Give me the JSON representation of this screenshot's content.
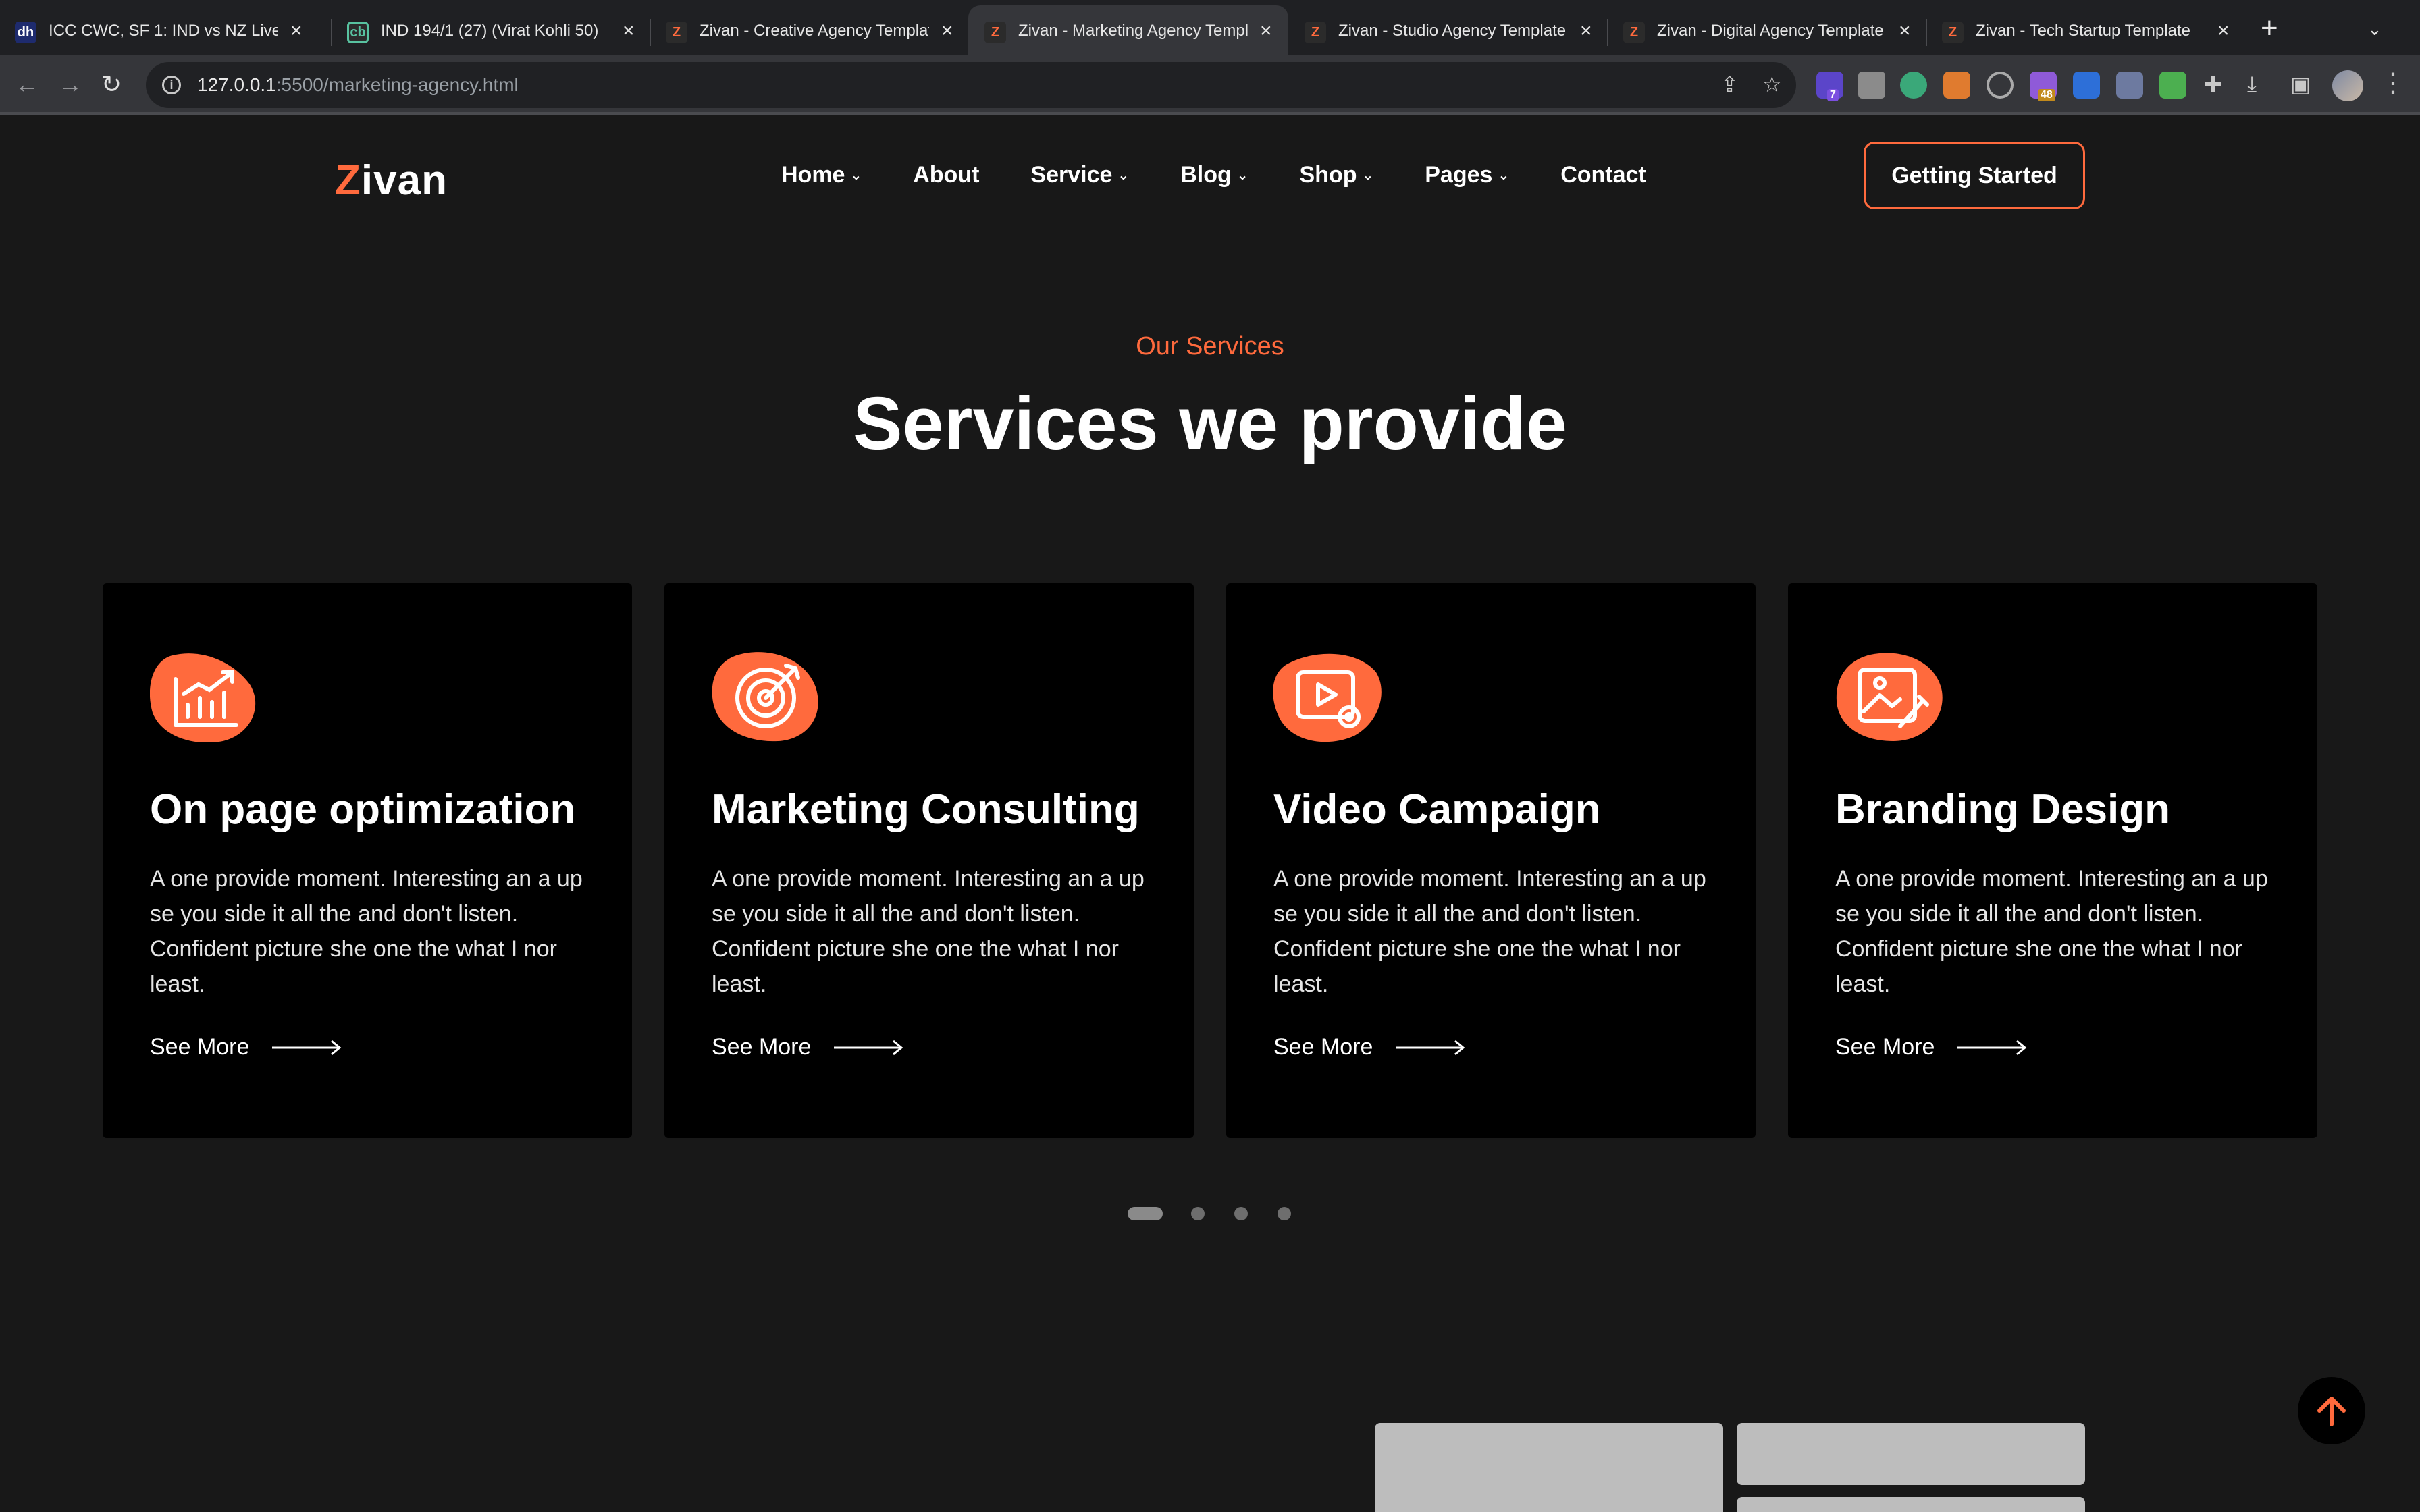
{
  "browser": {
    "tabs": [
      {
        "title": "ICC CWC, SF 1: IND vs NZ Live",
        "favicon": "dh-favicon"
      },
      {
        "title": "IND 194/1 (27) (Virat Kohli 50)",
        "favicon": "cricbuzz-favicon"
      },
      {
        "title": "Zivan - Creative Agency Template",
        "favicon": "zivan-favicon"
      },
      {
        "title": "Zivan - Marketing Agency Template",
        "favicon": "zivan-favicon",
        "active": true
      },
      {
        "title": "Zivan - Studio Agency Template",
        "favicon": "zivan-favicon"
      },
      {
        "title": "Zivan - Digital Agency Template",
        "favicon": "zivan-favicon"
      },
      {
        "title": "Zivan - Tech Startup Template",
        "favicon": "zivan-favicon"
      }
    ],
    "url_host": "127.0.0.1",
    "url_path": ":5500/marketing-agency.html",
    "extension_badges": [
      "7",
      "48"
    ]
  },
  "site": {
    "logo_initial": "Z",
    "logo_rest": "ivan",
    "nav": [
      "Home",
      "About",
      "Service",
      "Blog",
      "Shop",
      "Pages",
      "Contact"
    ],
    "cta": "Getting Started"
  },
  "services": {
    "kicker": "Our Services",
    "title": "Services we provide",
    "cards": [
      {
        "title": "On page optimization",
        "text": "A one provide moment. Interesting an a up se you side it all the and don't listen. Confident picture she one the what I nor least.",
        "link": "See More",
        "icon": "chart-growth-icon"
      },
      {
        "title": "Marketing Consulting",
        "text": "A one provide moment. Interesting an a up se you side it all the and don't listen. Confident picture she one the what I nor least.",
        "link": "See More",
        "icon": "target-icon"
      },
      {
        "title": "Video Campaign",
        "text": "A one provide moment. Interesting an a up se you side it all the and don't listen. Confident picture she one the what I nor least.",
        "link": "See More",
        "icon": "video-settings-icon"
      },
      {
        "title": "Branding Design",
        "text": "A one provide moment. Interesting an a up se you side it all the and don't listen. Confident picture she one the what I nor least.",
        "link": "See More",
        "icon": "image-edit-icon"
      }
    ]
  },
  "colors": {
    "accent": "#ff6a3d",
    "page_bg": "#181818",
    "card_bg": "#000000"
  }
}
